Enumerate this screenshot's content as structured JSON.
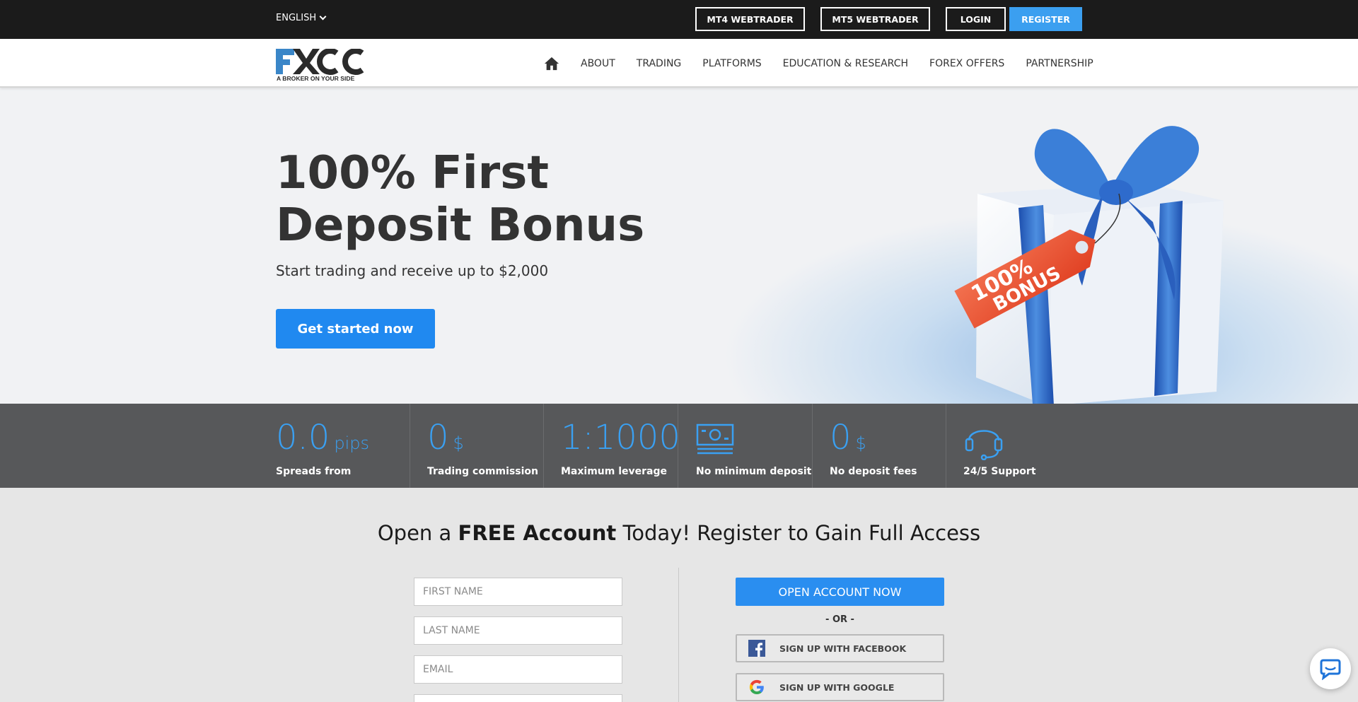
{
  "topbar": {
    "language": "ENGLISH",
    "mt4_label": "MT4 WEBTRADER",
    "mt5_label": "MT5 WEBTRADER",
    "login_label": "LOGIN",
    "register_label": "REGISTER"
  },
  "brand": {
    "logo_text": "FXCC",
    "tagline": "A BROKER ON YOUR SIDE",
    "colors": {
      "accent": "#2089f0",
      "topbar": "#1b1b1b",
      "stats_bg": "#57585a"
    }
  },
  "nav": {
    "home_icon": "home-icon",
    "items": [
      "ABOUT",
      "TRADING",
      "PLATFORMS",
      "EDUCATION & RESEARCH",
      "FOREX OFFERS",
      "PARTNERSHIP"
    ]
  },
  "hero": {
    "title": "100% First Deposit Bonus",
    "subtitle": "Start trading and receive up to $2,000",
    "cta_label": "Get started now",
    "tag_line1": "100%",
    "tag_line2": "BONUS"
  },
  "stats": [
    {
      "value": "0.0",
      "unit": "pips",
      "label": "Spreads from"
    },
    {
      "value": "0",
      "unit": "$",
      "label": "Trading commission"
    },
    {
      "value": "1:1000",
      "unit": "",
      "label": "Maximum leverage"
    },
    {
      "icon": "money-icon",
      "label": "No minimum deposit"
    },
    {
      "value": "0",
      "unit": "$",
      "label": "No deposit fees"
    },
    {
      "icon": "headset-icon",
      "label": "24/5 Support"
    }
  ],
  "register": {
    "title_pre": "Open a ",
    "title_bold": "FREE Account",
    "title_post": " Today! Register to Gain Full Access",
    "first_name_placeholder": "FIRST NAME",
    "last_name_placeholder": "LAST NAME",
    "email_placeholder": "EMAIL",
    "open_label": "OPEN ACCOUNT NOW",
    "or_label": "- OR -",
    "facebook_label": "SIGN UP WITH FACEBOOK",
    "google_label": "SIGN UP WITH GOOGLE"
  }
}
